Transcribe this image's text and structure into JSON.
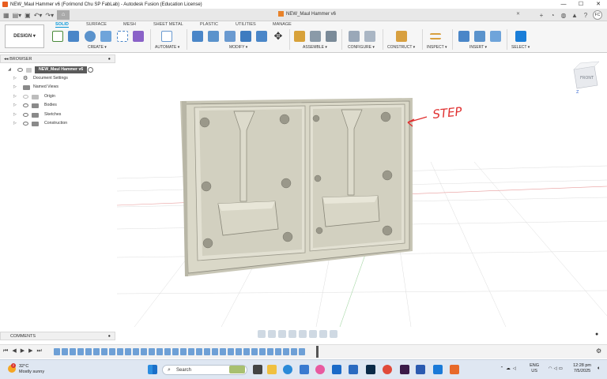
{
  "window": {
    "title": "NEW_Maul Hammer v6 (Forimond Chu SP FabLab) - Autodesk Fusion (Education License)",
    "buttons": [
      "—",
      "☐",
      "✕"
    ]
  },
  "document_tab": {
    "label": "NEW_Maul Hammer v6",
    "close": "✕"
  },
  "user_initials": "FC",
  "toolbar": {
    "design_label": "DESIGN ▾",
    "workspace_tabs": [
      "SOLID",
      "SURFACE",
      "MESH",
      "SHEET METAL",
      "PLASTIC",
      "UTILITIES",
      "MANAGE"
    ],
    "groups": [
      "CREATE ▾",
      "AUTOMATE ▾",
      "MODIFY ▾",
      "ASSEMBLE ▾",
      "CONFIGURE ▾",
      "CONSTRUCT ▾",
      "INSPECT ▾",
      "INSERT ▾",
      "SELECT ▾"
    ]
  },
  "browser": {
    "header": "BROWSER",
    "root": "NEW_Maul Hammer v6",
    "items": [
      "Document Settings",
      "Named Views",
      "Origin",
      "Bodies",
      "Sketches",
      "Construction"
    ]
  },
  "viewcube": {
    "face": "FRONT",
    "axis_z": "Z"
  },
  "annotation": {
    "text": "STEP"
  },
  "comments": {
    "label": "COMMENTS"
  },
  "taskbar": {
    "weather_temp": "32°C",
    "weather_desc": "Mostly sunny",
    "weather_badge": "2",
    "search_placeholder": "Search",
    "lang": "ENG",
    "region": "US",
    "time": "12:28 pm",
    "date": "7/5/2025"
  },
  "colors": {
    "accent": "#0696d7",
    "part": "#d8d6c6",
    "part_dark": "#a8a696",
    "annotation": "#e03030"
  }
}
